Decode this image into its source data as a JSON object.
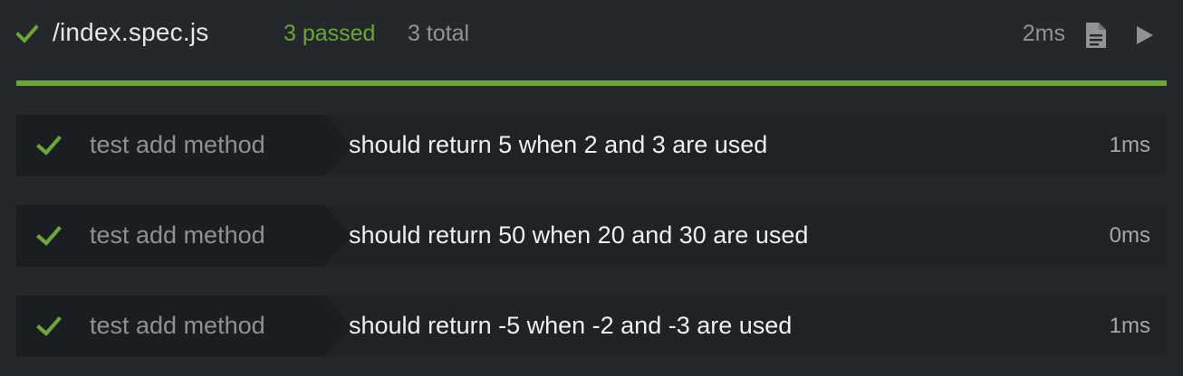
{
  "header": {
    "file_name": "/index.spec.js",
    "passed_label": "3 passed",
    "total_label": "3 total",
    "duration": "2ms",
    "status": "passed",
    "status_icon": "check-icon",
    "file_icon": "file-icon",
    "run_icon": "play-icon"
  },
  "progress": {
    "passed_fraction": 1.0
  },
  "colors": {
    "background": "#24272b",
    "row_background": "#1f2226",
    "pass": "#6aa734",
    "muted": "#909398",
    "text": "#f0f0f0"
  },
  "tests": [
    {
      "suite": "test add method",
      "title": "should return 5 when 2 and 3 are used",
      "duration": "1ms",
      "status": "passed"
    },
    {
      "suite": "test add method",
      "title": "should return 50 when 20 and 30 are used",
      "duration": "0ms",
      "status": "passed"
    },
    {
      "suite": "test add method",
      "title": "should return -5 when -2 and -3 are used",
      "duration": "1ms",
      "status": "passed"
    }
  ]
}
